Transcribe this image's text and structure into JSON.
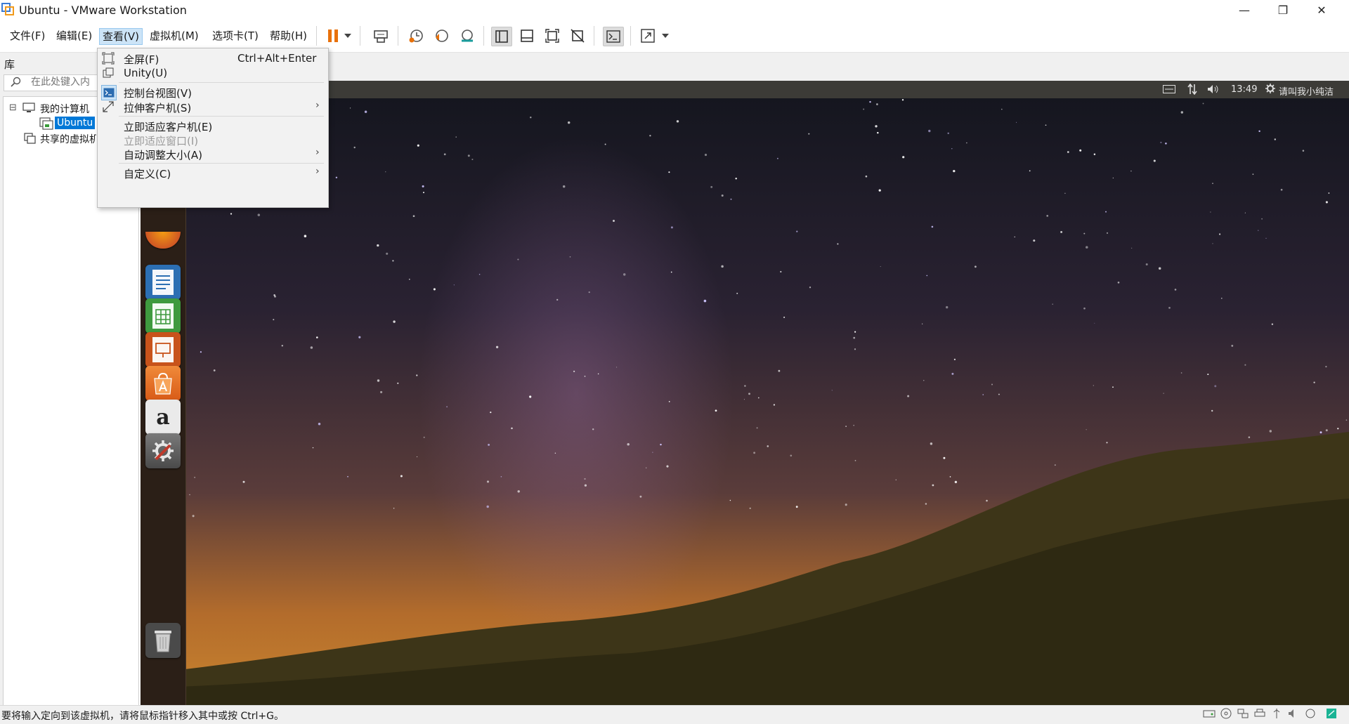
{
  "window": {
    "title": "Ubuntu - VMware Workstation",
    "controls": {
      "minimize": "—",
      "maximize": "❐",
      "close": "✕"
    }
  },
  "menubar": {
    "items": [
      "文件(F)",
      "编辑(E)",
      "查看(V)",
      "虚拟机(M)",
      "选项卡(T)",
      "帮助(H)"
    ]
  },
  "toolbar": {
    "icons": [
      "pause-icon",
      "dropdown-arrow-icon",
      "send-ctrl-alt-del-icon",
      "snapshot-take-icon",
      "snapshot-revert-icon",
      "snapshot-manager-icon",
      "library-view-icon",
      "thumbnail-bar-icon",
      "fullscreen-icon",
      "unity-icon",
      "console-view-icon",
      "stretch-icon",
      "dropdown-arrow-icon"
    ]
  },
  "library": {
    "header": "库",
    "search_placeholder": "在此处键入内",
    "tree": [
      {
        "label": "我的计算机",
        "expander": "⊟"
      },
      {
        "label": "Ubuntu",
        "selected": true
      },
      {
        "label": "共享的虚拟机"
      }
    ]
  },
  "view_menu": {
    "items": [
      {
        "label": "全屏(F)",
        "shortcut": "Ctrl+Alt+Enter",
        "icon": "fullscreen-icon"
      },
      {
        "label": "Unity(U)",
        "icon": "unity-icon"
      },
      {
        "label": "控制台视图(V)",
        "icon": "console-view-icon",
        "checked": true
      },
      {
        "label": "拉伸客户机(S)",
        "icon": "stretch-icon",
        "submenu": "›"
      },
      {
        "label": "立即适应客户机(E)"
      },
      {
        "label": "立即适应窗口(I)",
        "disabled": true
      },
      {
        "label": "自动调整大小(A)",
        "submenu": "›"
      },
      {
        "label": "自定义(C)",
        "submenu": "›"
      }
    ]
  },
  "guest": {
    "panel": {
      "time": "13:49",
      "user": "请叫我小纯洁"
    },
    "launcher_icons": [
      "firefox-icon",
      "writer-icon",
      "calc-icon",
      "impress-icon",
      "software-center-icon",
      "amazon-icon",
      "settings-icon",
      "trash-icon"
    ],
    "amazon_glyph": "a"
  },
  "statusbar": {
    "text": "要将输入定向到该虚拟机，请将鼠标指针移入其中或按 Ctrl+G。",
    "icons": [
      "hdd-icon",
      "cd-icon",
      "network-icon",
      "printer-icon",
      "usb-icon",
      "sound-icon",
      "display-icon",
      "notes-icon"
    ]
  },
  "colors": {
    "accent": "#0078d7",
    "menu_highlight": "#cce4f7",
    "pause": "#e8710a"
  }
}
